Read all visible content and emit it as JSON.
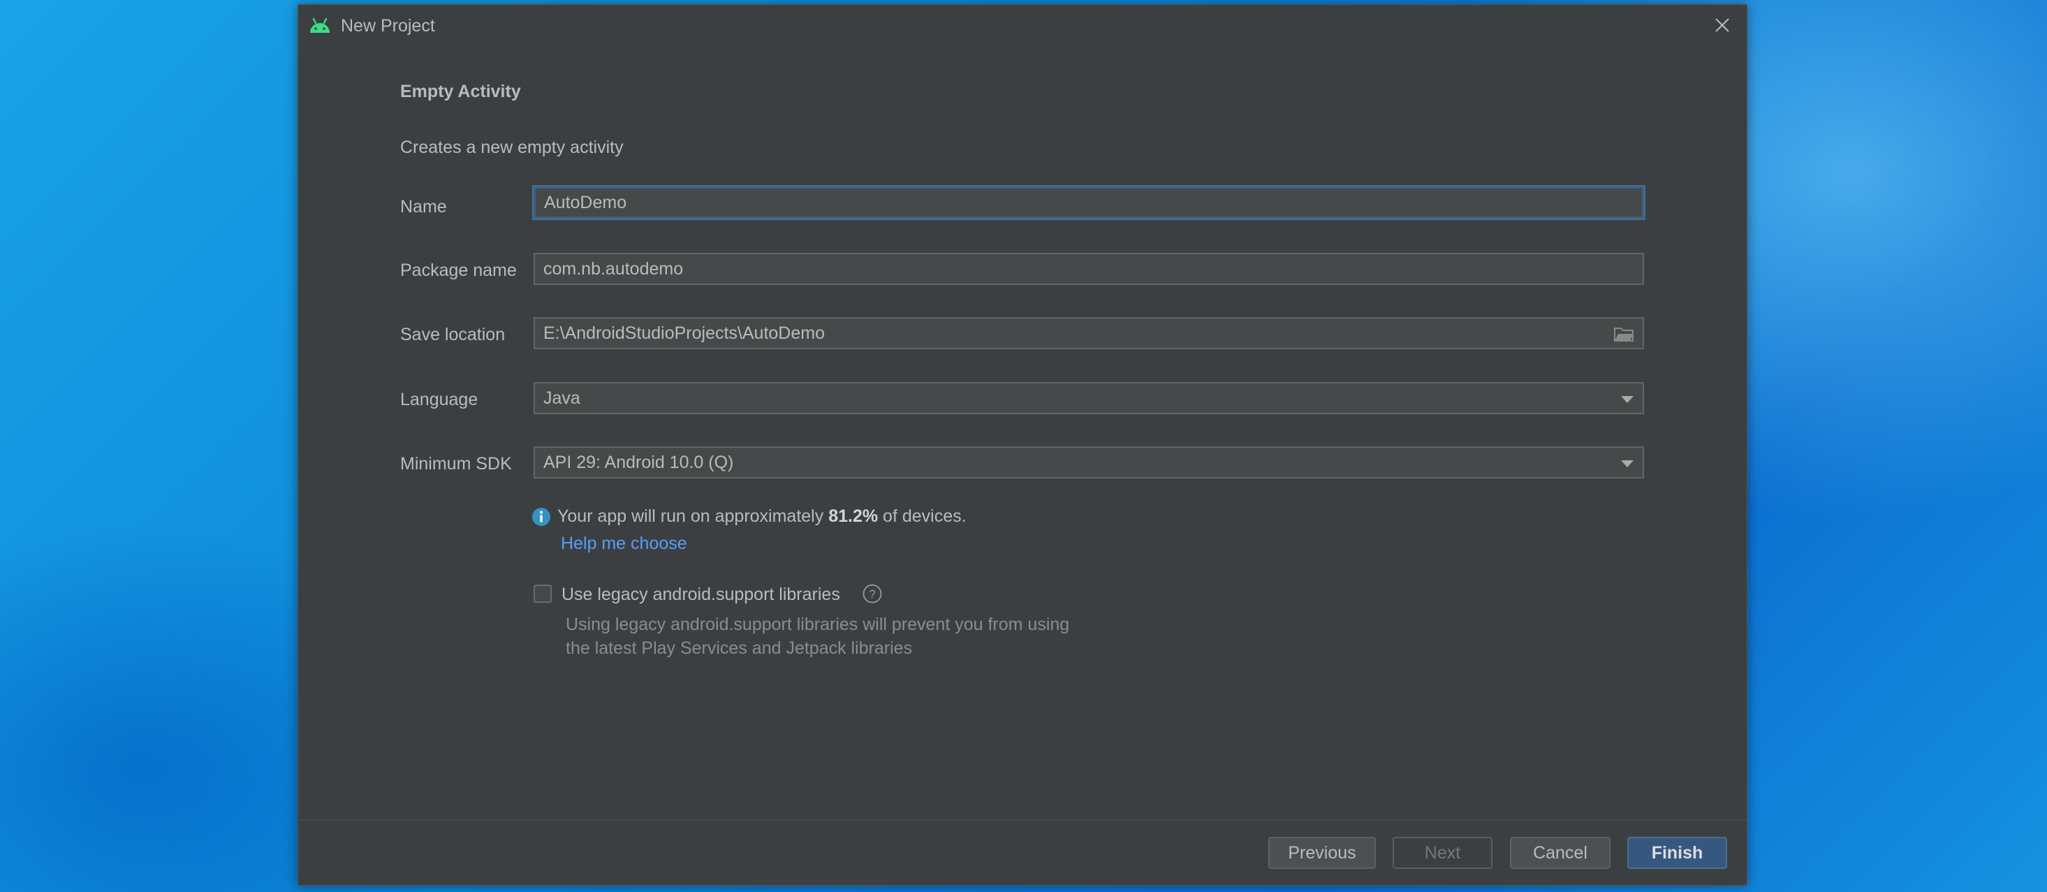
{
  "window": {
    "title": "New Project",
    "icon": "android-icon",
    "close_icon": "close-icon"
  },
  "form": {
    "heading": "Empty Activity",
    "description": "Creates a new empty activity",
    "name": {
      "label": "Name",
      "value": "AutoDemo"
    },
    "package_name": {
      "label": "Package name",
      "value": "com.nb.autodemo"
    },
    "save_location": {
      "label": "Save location",
      "value": "E:\\AndroidStudioProjects\\AutoDemo",
      "icon": "folder-icon"
    },
    "language": {
      "label": "Language",
      "value": "Java"
    },
    "minimum_sdk": {
      "label": "Minimum SDK",
      "value": "API 29: Android 10.0 (Q)"
    },
    "info": {
      "prefix": "Your app will run on approximately",
      "percentage": "81.2%",
      "suffix": "of devices.",
      "help_link": "Help me choose"
    },
    "legacy": {
      "label": "Use legacy android.support libraries",
      "checked": false,
      "desc_line1": "Using legacy android.support libraries will prevent you from using",
      "desc_line2": "the latest Play Services and Jetpack libraries"
    }
  },
  "buttons": {
    "previous": "Previous",
    "next": "Next",
    "cancel": "Cancel",
    "finish": "Finish"
  },
  "colors": {
    "dialog_bg": "#3c3f41",
    "link": "#589df6",
    "primary_button": "#365880",
    "info_icon": "#3592c4",
    "android_green": "#3ddc84"
  }
}
